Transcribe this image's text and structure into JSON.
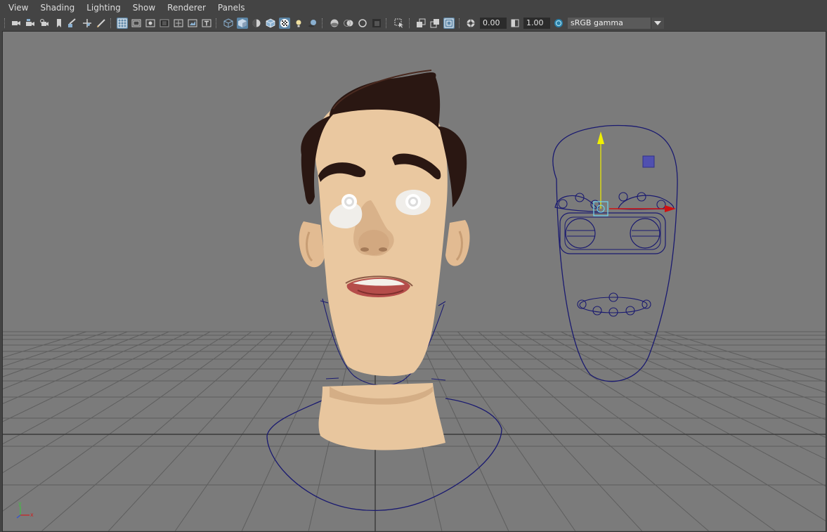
{
  "menubar": {
    "items": [
      "View",
      "Shading",
      "Lighting",
      "Show",
      "Renderer",
      "Panels"
    ]
  },
  "toolbar": {
    "exposure_value": "0.00",
    "gamma_value": "1.00",
    "color_space": "sRGB gamma",
    "icons": [
      "select-camera-icon",
      "camera-attributes-icon",
      "bookmark-icon",
      "image-plane-icon",
      "2d-pan-zoom-icon",
      "grease-pencil-icon",
      "grid-icon",
      "film-gate-icon",
      "resolution-gate-icon",
      "gate-mask-icon",
      "field-chart-icon",
      "safe-action-icon",
      "safe-title-icon",
      "wireframe-icon",
      "smooth-shade-icon",
      "shade-default-icon",
      "wireframe-on-shaded-icon",
      "textured-icon",
      "use-all-lights-icon",
      "shadows-icon",
      "screen-space-ao-icon",
      "motion-blur-icon",
      "multisample-aa-icon",
      "depth-of-field-icon",
      "isolate-select-icon",
      "xray-icon",
      "xray-active-components-icon",
      "xray-joints-icon",
      "exposure-icon",
      "gamma-icon",
      "color-management-icon"
    ]
  },
  "viewport": {
    "background_color": "#7b7b7b",
    "grid_color": "#5e5e5e",
    "grid_axis_color": "#3a3a3a",
    "controller_color": "#1a1a70",
    "skin_color": "#eac8a0",
    "hair_color": "#2a1712",
    "axis_labels": {
      "y": "y",
      "x": "x"
    }
  }
}
